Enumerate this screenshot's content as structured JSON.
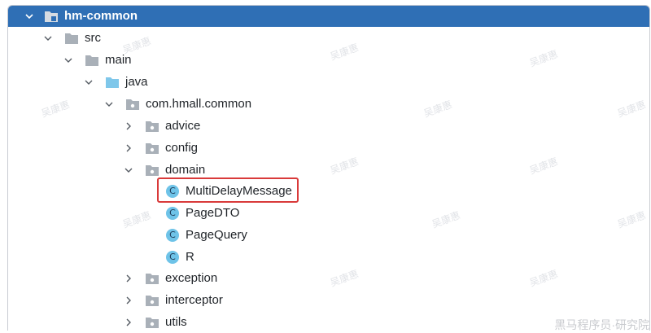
{
  "tree": {
    "root": {
      "label": "hm-common"
    },
    "src": {
      "label": "src"
    },
    "main": {
      "label": "main"
    },
    "java": {
      "label": "java"
    },
    "package": {
      "label": "com.hmall.common"
    },
    "advice": {
      "label": "advice"
    },
    "config": {
      "label": "config"
    },
    "domain": {
      "label": "domain"
    },
    "classes": [
      {
        "label": "MultiDelayMessage",
        "badge": "C"
      },
      {
        "label": "PageDTO",
        "badge": "C"
      },
      {
        "label": "PageQuery",
        "badge": "C"
      },
      {
        "label": "R",
        "badge": "C"
      }
    ],
    "exception": {
      "label": "exception"
    },
    "interceptor": {
      "label": "interceptor"
    },
    "utils": {
      "label": "utils"
    }
  },
  "watermark": "吴康惠",
  "footer": "黑马程序员·研究院",
  "colors": {
    "selection": "#2f6fb5",
    "highlight_border": "#d93a3a",
    "class_badge": "#6ec3e8",
    "folder": "#a9b0b8",
    "source_folder": "#7fc7ea"
  }
}
